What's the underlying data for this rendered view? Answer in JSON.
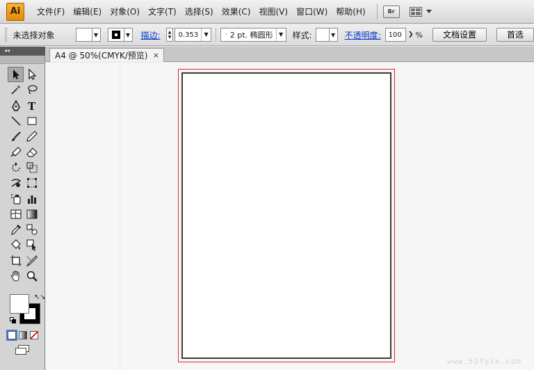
{
  "app": {
    "logo": "Ai"
  },
  "menu": [
    "文件(F)",
    "编辑(E)",
    "对象(O)",
    "文字(T)",
    "选择(S)",
    "效果(C)",
    "视图(V)",
    "窗口(W)",
    "帮助(H)"
  ],
  "menu_extras": {
    "bridge_label": "Br",
    "arrange_icon": "arrange-documents-icon"
  },
  "control": {
    "selection_status": "未选择对象",
    "stroke_label": "描边:",
    "stroke_weight": "0.353",
    "brush_value": "2 pt. 椭圆形",
    "style_label": "样式:",
    "opacity_label": "不透明度:",
    "opacity_value": "100",
    "opacity_unit": "%",
    "doc_setup_button": "文档设置",
    "prefs_button": "首选"
  },
  "toolbox_strip": "◂◂",
  "document": {
    "tab_title": "A4 @ 50%(CMYK/预览)",
    "close_glyph": "×"
  },
  "tools": [
    "selection-tool",
    "direct-selection-tool",
    "magic-wand-tool",
    "lasso-tool",
    "pen-tool",
    "type-tool",
    "line-segment-tool",
    "rectangle-tool",
    "paintbrush-tool",
    "pencil-tool",
    "blob-brush-tool",
    "eraser-tool",
    "rotate-tool",
    "scale-tool",
    "warp-tool",
    "free-transform-tool",
    "symbol-sprayer-tool",
    "column-graph-tool",
    "mesh-tool",
    "gradient-tool",
    "eyedropper-tool",
    "blend-tool",
    "live-paint-bucket-tool",
    "live-paint-selection-tool",
    "artboard-tool",
    "slice-tool",
    "hand-tool",
    "zoom-tool"
  ],
  "colors": {
    "fill": "#ffffff",
    "stroke": "#000000",
    "bleed_guide": "#e3262b",
    "artboard_border": "#3a3a3a",
    "app_logo": "#f0a11f"
  },
  "watermark": "www.52fyin.com"
}
